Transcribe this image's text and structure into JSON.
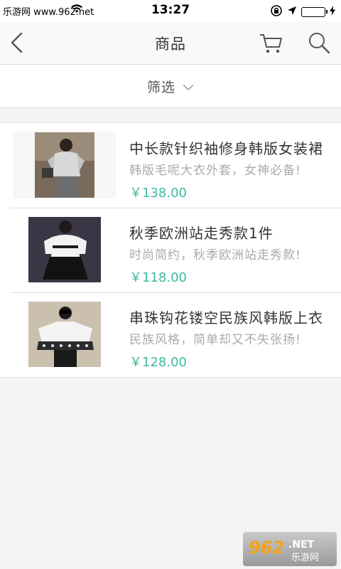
{
  "status_bar": {
    "carrier_text": "乐游网 www.962.net",
    "time": "13:27"
  },
  "nav": {
    "title": "商品",
    "icons": [
      "back-icon",
      "cart-icon",
      "search-icon"
    ]
  },
  "filter": {
    "label": "筛选"
  },
  "products": [
    {
      "title": "中长款针织袖修身韩版女装裙",
      "subtitle": "韩版毛呢大衣外套，女神必备!",
      "price": "￥138.00"
    },
    {
      "title": "秋季欧洲站走秀款1件",
      "subtitle": "时尚简约，秋季欧洲站走秀款!",
      "price": "￥118.00"
    },
    {
      "title": "串珠钩花镂空民族风韩版上衣",
      "subtitle": "民族风格，简单却又不失张扬!",
      "price": "￥128.00"
    }
  ],
  "watermark": {
    "brand": "962.NET",
    "text": "乐游网"
  },
  "colors": {
    "price": "#3fb9a0",
    "battery": "#3ac84d"
  }
}
